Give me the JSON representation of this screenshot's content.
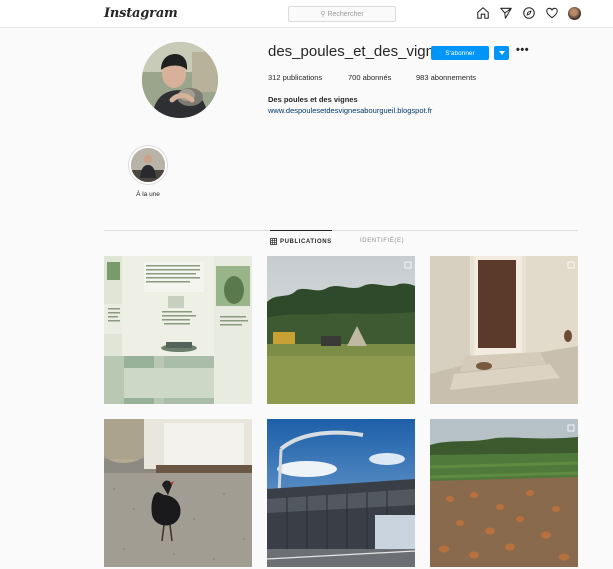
{
  "header": {
    "logo": "Instagram",
    "search_placeholder": "Rechercher",
    "icons": [
      "home-icon",
      "direct-icon",
      "explore-icon",
      "heart-icon",
      "avatar"
    ]
  },
  "profile": {
    "username": "des_poules_et_des_vignes",
    "follow_label": "S'abonner",
    "more_label": "•••",
    "stats": {
      "posts": "312 publications",
      "followers": "700 abonnés",
      "following": "983 abonnements"
    },
    "full_name": "Des poules et des vignes",
    "website": "www.despoulesetdesvignesabourgueil.blogspot.fr"
  },
  "highlights": [
    {
      "label": "À la une"
    }
  ],
  "tabs": [
    {
      "label": "PUBLICATIONS",
      "active": true
    },
    {
      "label": "IDENTIFIÉ(E)",
      "active": false
    }
  ],
  "colors": {
    "accent": "#0095f6",
    "link": "#00376b",
    "background": "#fafafa"
  }
}
